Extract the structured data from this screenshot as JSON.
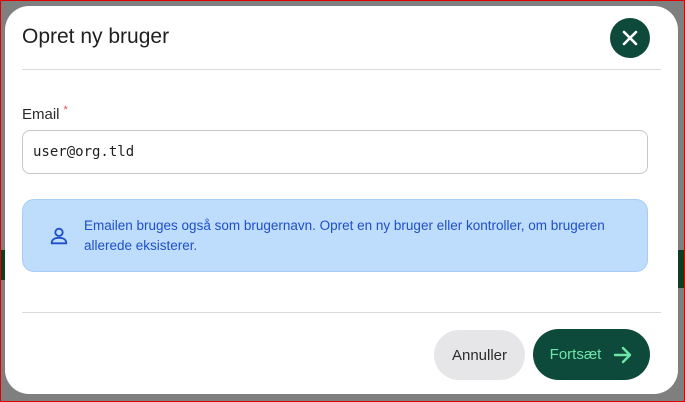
{
  "dialog": {
    "title": "Opret ny bruger",
    "close_icon": "close-icon",
    "email": {
      "label": "Email",
      "required_marker": "*",
      "value": "user@org.tld"
    },
    "info": {
      "icon": "user-icon",
      "text": "Emailen bruges også som brugernavn. Opret en ny bruger eller kontroller, om brugeren allerede eksisterer."
    },
    "buttons": {
      "cancel_label": "Annuller",
      "continue_label": "Fortsæt",
      "continue_icon": "arrow-right-icon"
    }
  },
  "colors": {
    "primary": "#0e4a3b",
    "primary_text": "#6ee6a8",
    "info_bg": "#bedcfb",
    "info_text": "#1e50c8",
    "cancel_bg": "#e6e6e8",
    "overlay": "#7f7f7f"
  }
}
